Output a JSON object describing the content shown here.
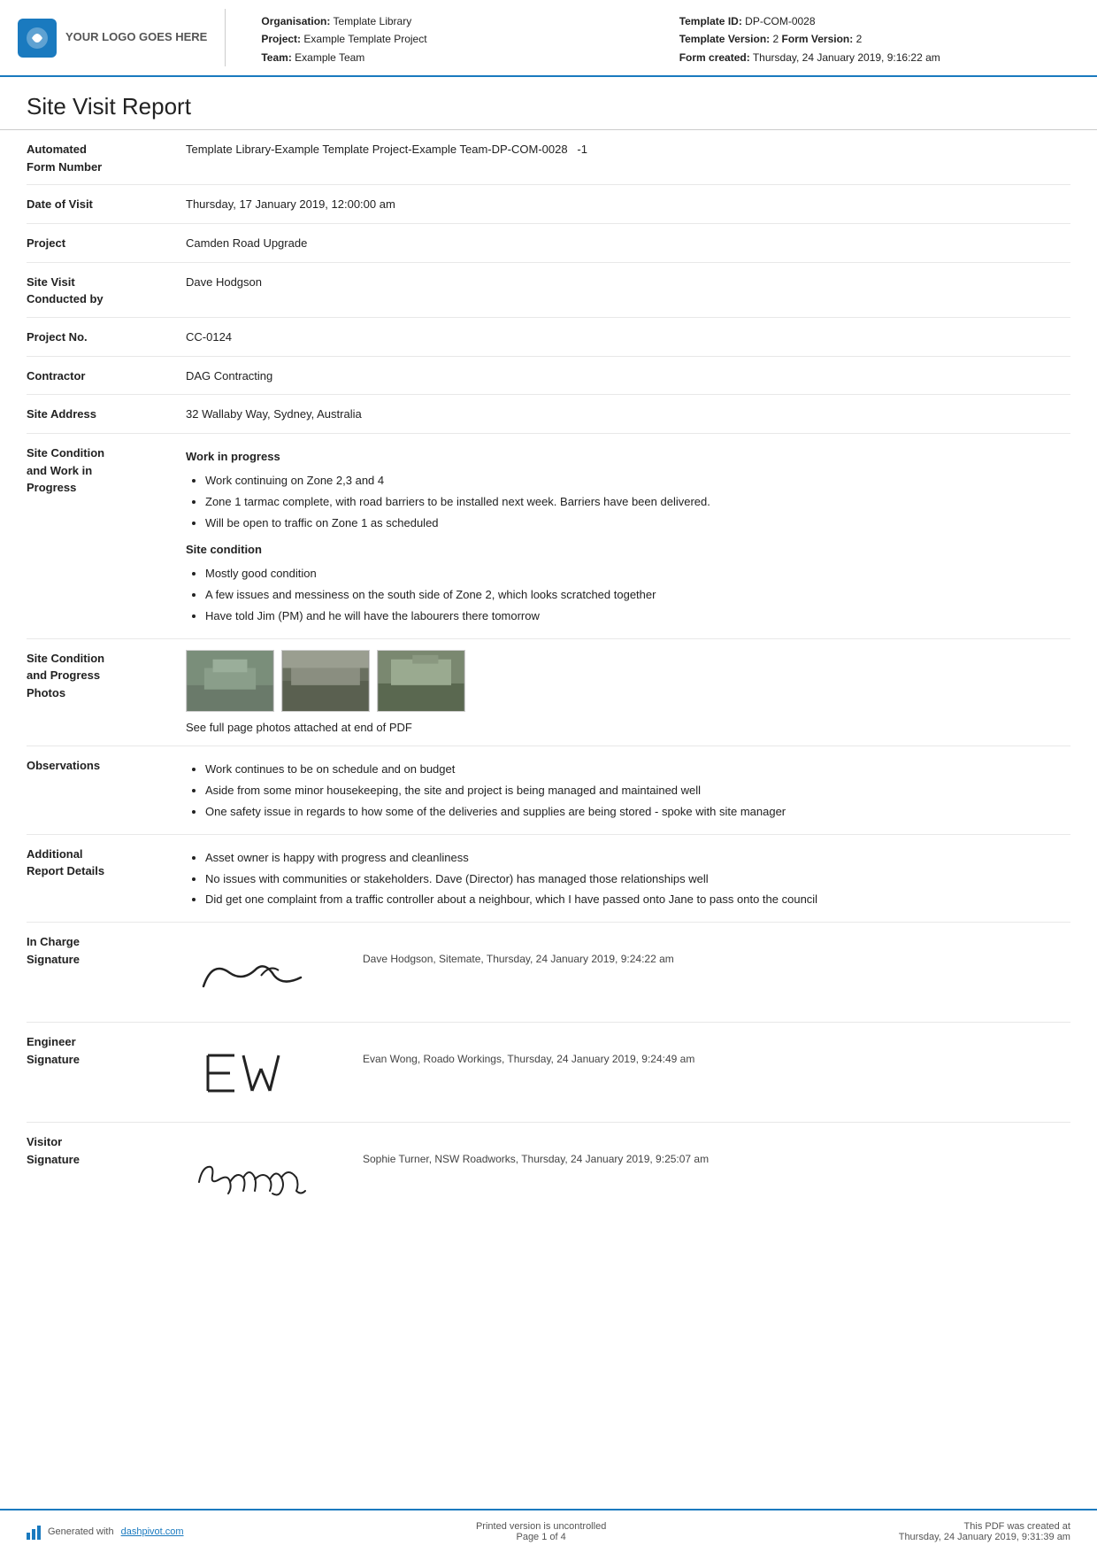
{
  "header": {
    "logo_text": "YOUR LOGO GOES HERE",
    "org_label": "Organisation:",
    "org_value": "Template Library",
    "project_label": "Project:",
    "project_value": "Example Template Project",
    "team_label": "Team:",
    "team_value": "Example Team",
    "template_id_label": "Template ID:",
    "template_id_value": "DP-COM-0028",
    "template_version_label": "Template Version:",
    "template_version_value": "2",
    "form_version_label": "Form Version:",
    "form_version_value": "2",
    "form_created_label": "Form created:",
    "form_created_value": "Thursday, 24 January 2019, 9:16:22 am"
  },
  "report": {
    "title": "Site Visit Report",
    "fields": [
      {
        "label": "Automated\nForm Number",
        "value": "Template Library-Example Template Project-Example Team-DP-COM-0028   -1"
      },
      {
        "label": "Date of Visit",
        "value": "Thursday, 17 January 2019, 12:00:00 am"
      },
      {
        "label": "Project",
        "value": "Camden Road Upgrade"
      },
      {
        "label": "Site Visit\nConducted by",
        "value": "Dave Hodgson"
      },
      {
        "label": "Project No.",
        "value": "CC-0124"
      },
      {
        "label": "Contractor",
        "value": "DAG Contracting"
      },
      {
        "label": "Site Address",
        "value": "32 Wallaby Way, Sydney, Australia"
      }
    ],
    "site_condition": {
      "label": "Site Condition\nand Work in\nProgress",
      "work_header": "Work in progress",
      "work_items": [
        "Work continuing on Zone 2,3 and 4",
        "Zone 1 tarmac complete, with road barriers to be installed next week. Barriers have been delivered.",
        "Will be open to traffic on Zone 1 as scheduled"
      ],
      "condition_header": "Site condition",
      "condition_items": [
        "Mostly good condition",
        "A few issues and messiness on the south side of Zone 2, which looks scratched together",
        "Have told Jim (PM) and he will have the labourers there tomorrow"
      ]
    },
    "photos": {
      "label": "Site Condition\nand Progress\nPhotos",
      "caption": "See full page photos attached at end of PDF"
    },
    "observations": {
      "label": "Observations",
      "items": [
        "Work continues to be on schedule and on budget",
        "Aside from some minor housekeeping, the site and project is being managed and maintained well",
        "One safety issue in regards to how some of the deliveries and supplies are being stored - spoke with site manager"
      ]
    },
    "additional": {
      "label": "Additional\nReport Details",
      "items": [
        "Asset owner is happy with progress and cleanliness",
        "No issues with communities or stakeholders. Dave (Director) has managed those relationships well",
        "Did get one complaint from a traffic controller about a neighbour, which I have passed onto Jane to pass onto the council"
      ]
    },
    "signatures": [
      {
        "label": "In Charge\nSignature",
        "sig_type": "cursive1",
        "info": "Dave Hodgson, Sitemate, Thursday, 24 January 2019, 9:24:22 am"
      },
      {
        "label": "Engineer\nSignature",
        "sig_type": "cursive2",
        "info": "Evan Wong, Roado Workings, Thursday, 24 January 2019, 9:24:49 am"
      },
      {
        "label": "Visitor\nSignature",
        "sig_type": "cursive3",
        "info": "Sophie Turner, NSW Roadworks, Thursday, 24 January 2019, 9:25:07 am"
      }
    ]
  },
  "footer": {
    "generated_prefix": "Generated with ",
    "generated_link": "dashpivot.com",
    "uncontrolled": "Printed version is uncontrolled",
    "page": "Page 1 of 4",
    "pdf_created": "This PDF was created at",
    "pdf_date": "Thursday, 24 January 2019, 9:31:39 am"
  }
}
